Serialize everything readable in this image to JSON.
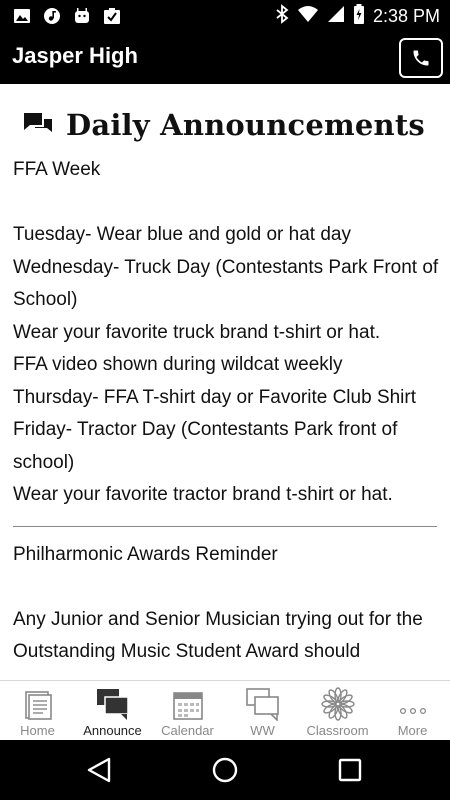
{
  "status_bar": {
    "time": "2:38 PM",
    "left_icons": [
      "image-icon",
      "music-icon",
      "android-icon",
      "download-icon"
    ],
    "right_icons": [
      "bluetooth-icon",
      "wifi-icon",
      "signal-icon",
      "battery-icon"
    ]
  },
  "app_bar": {
    "title": "Jasper High",
    "call_icon": "phone-icon"
  },
  "section": {
    "icon": "chat-icon",
    "title": "Daily Announcements"
  },
  "announcements": [
    {
      "title": "FFA Week",
      "lines": [
        "",
        "Tuesday- Wear blue and gold or hat day",
        "Wednesday- Truck Day (Contestants Park Front of School)",
        "Wear your favorite truck brand t-shirt or hat.",
        "FFA video shown during wildcat weekly",
        "Thursday- FFA T-shirt day or Favorite Club Shirt",
        "Friday- Tractor Day (Contestants Park front of school)",
        "Wear your favorite tractor brand t-shirt or hat."
      ]
    },
    {
      "title": "Philharmonic Awards Reminder",
      "lines": [
        "",
        "Any Junior and Senior Musician trying out for the Outstanding Music Student Award should"
      ]
    }
  ],
  "tabs": [
    {
      "label": "Home",
      "icon": "home-doc-icon",
      "active": false
    },
    {
      "label": "Announce",
      "icon": "chat-icon",
      "active": true
    },
    {
      "label": "Calendar",
      "icon": "calendar-icon",
      "active": false
    },
    {
      "label": "WW",
      "icon": "chat-outline-icon",
      "active": false
    },
    {
      "label": "Classroom",
      "icon": "flower-icon",
      "active": false
    },
    {
      "label": "More",
      "icon": "more-dots-icon",
      "active": false
    }
  ],
  "nav_bar": {
    "buttons": [
      "back-icon",
      "home-icon",
      "recents-icon"
    ]
  },
  "colors": {
    "bar_background": "#000000",
    "content_background": "#ffffff",
    "text": "#111111",
    "inactive_tab": "#888888"
  }
}
